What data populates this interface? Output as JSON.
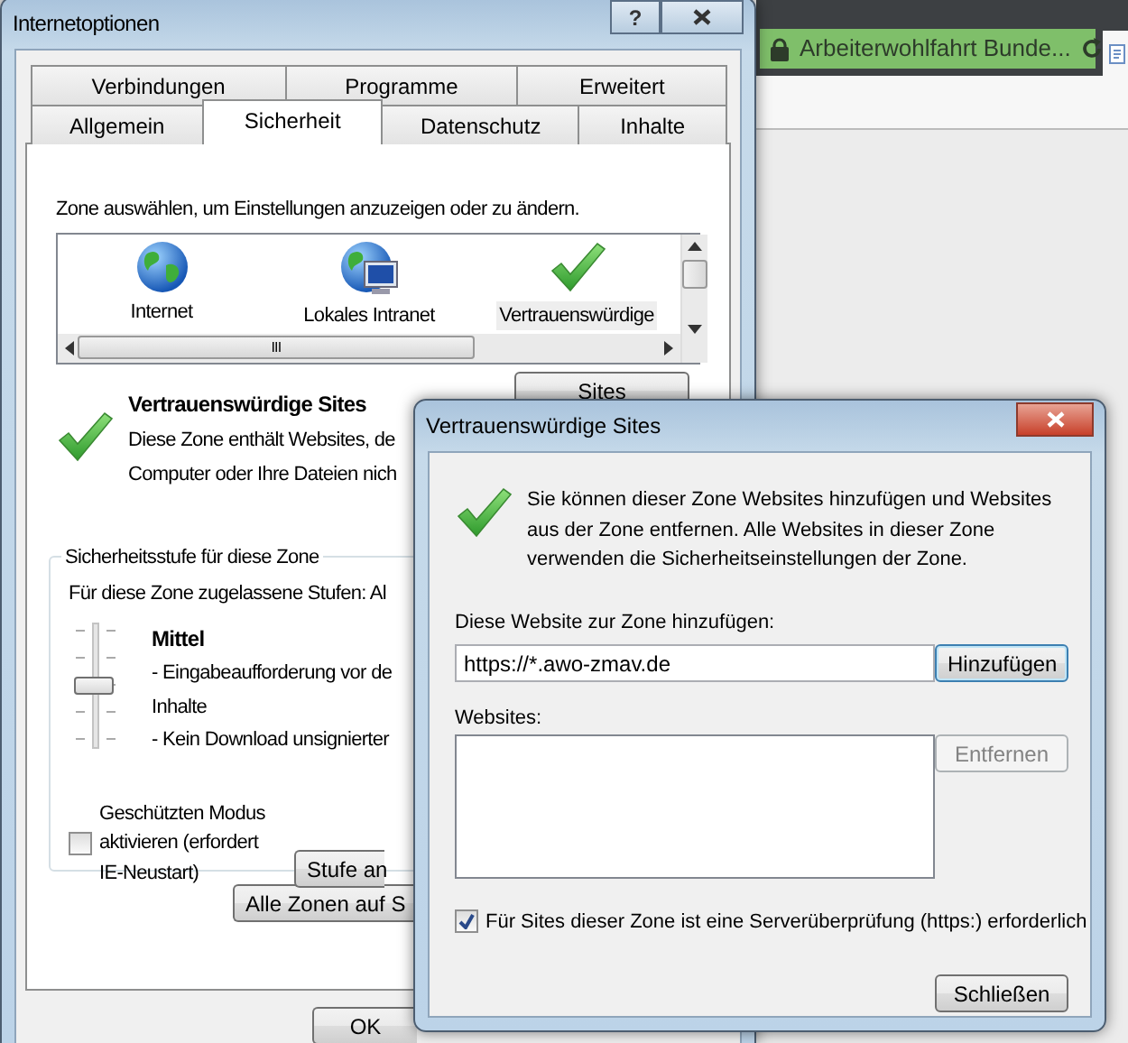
{
  "browser": {
    "address_text": "Arbeiterwohlfahrt Bunde..."
  },
  "internet_options": {
    "title": "Internetoptionen",
    "help_button": "?",
    "tab_rows": [
      [
        {
          "label": "Verbindungen",
          "selected": false
        },
        {
          "label": "Programme",
          "selected": false
        },
        {
          "label": "Erweitert",
          "selected": false
        }
      ],
      [
        {
          "label": "Allgemein",
          "selected": false
        },
        {
          "label": "Sicherheit",
          "selected": true
        },
        {
          "label": "Datenschutz",
          "selected": false
        },
        {
          "label": "Inhalte",
          "selected": false
        }
      ]
    ],
    "zone_prompt": "Zone auswählen, um Einstellungen anzuzeigen oder zu ändern.",
    "zones": [
      {
        "label": "Internet",
        "kind": "globe",
        "selected": false
      },
      {
        "label": "Lokales Intranet",
        "kind": "intranet",
        "selected": false
      },
      {
        "label": "Vertrauenswürdige",
        "kind": "check",
        "selected": true
      }
    ],
    "scroll_grip": "III",
    "sites_button": "Sites",
    "zone_title": "Vertrauenswürdige Sites",
    "zone_description": [
      "Diese Zone enthält Websites, de",
      "Computer oder Ihre Dateien nich"
    ],
    "security_level": {
      "group_title": "Sicherheitsstufe für diese Zone",
      "allowed_levels": "Für diese Zone zugelassene Stufen: Al",
      "level": 0.5,
      "level_name": "Mittel",
      "level_details": [
        "- Eingabeaufforderung vor de",
        "Inhalte",
        "- Kein Download unsignierter"
      ]
    },
    "protected_mode": {
      "label": "Geschützten Modus aktivieren (erfordert IE-Neustart)",
      "checked": false
    },
    "custom_level_button": "Stufe an",
    "default_level_button": "Alle Zonen auf S",
    "ok_button": "OK"
  },
  "trusted_sites_dialog": {
    "title": "Vertrauenswürdige Sites",
    "description": "Sie können dieser Zone Websites hinzufügen und Websites aus der Zone entfernen. Alle Websites in dieser Zone verwenden die Sicherheitseinstellungen der Zone.",
    "add_label": "Diese Website zur Zone hinzufügen:",
    "add_value": "https://*.awo-zmav.de",
    "add_button": "Hinzufügen",
    "websites_label": "Websites:",
    "remove_button": {
      "label": "Entfernen",
      "disabled": true
    },
    "require_https": {
      "label": "Für Sites dieser Zone ist eine Serverüberprüfung (https:) erforderlich",
      "checked": true
    },
    "close_button": "Schließen"
  }
}
